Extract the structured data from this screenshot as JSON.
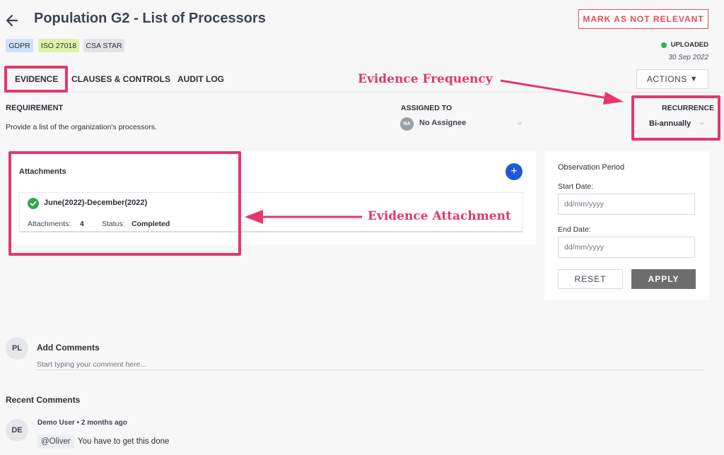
{
  "header": {
    "title": "Population G2 - List of Processors",
    "mark_button": "MARK AS NOT RELEVANT",
    "tags": [
      {
        "label": "GDPR",
        "color": "#cfe0fb"
      },
      {
        "label": "ISO 27018",
        "color": "#dff3a8"
      },
      {
        "label": "CSA STAR",
        "color": "#e3e4e7"
      }
    ],
    "status": "UPLOADED",
    "status_date": "30 Sep 2022",
    "status_color": "#2fb14f"
  },
  "tabs": [
    {
      "label": "EVIDENCE",
      "active": true
    },
    {
      "label": "CLAUSES & CONTROLS",
      "active": false
    },
    {
      "label": "AUDIT LOG",
      "active": false
    }
  ],
  "actions_label": "ACTIONS",
  "actions_arrow": "▼",
  "requirement": {
    "heading": "REQUIREMENT",
    "text": "Provide a list of the organization's processors."
  },
  "assigned": {
    "heading": "ASSIGNED TO",
    "initials": "NA",
    "value": "No Assignee"
  },
  "recurrence": {
    "heading": "RECURRENCE",
    "value": "Bi-annually"
  },
  "attachments": {
    "heading": "Attachments",
    "add_symbol": "+",
    "items": [
      {
        "period": "June(2022)-December(2022)",
        "attachments_label": "Attachments:",
        "attachments_count": "4",
        "status_label": "Status:",
        "status_value": "Completed"
      }
    ]
  },
  "observation": {
    "heading": "Observation Period",
    "start_label": "Start Date:",
    "start_placeholder": "dd/mm/yyyy",
    "end_label": "End Date:",
    "end_placeholder": "dd/mm/yyyy",
    "reset_label": "RESET",
    "apply_label": "APPLY"
  },
  "comments": {
    "user_initials": "PL",
    "add_heading": "Add Comments",
    "placeholder": "Start typing your comment here...",
    "recent_heading": "Recent Comments",
    "items": [
      {
        "initials": "DE",
        "author_line": "Demo User • 2 months ago",
        "mention": "@Oliver",
        "text": "You have to get this done"
      }
    ]
  },
  "annotations": {
    "frequency": "Evidence Frequency",
    "attachment": "Evidence Attachment",
    "color": "#e3386a"
  }
}
